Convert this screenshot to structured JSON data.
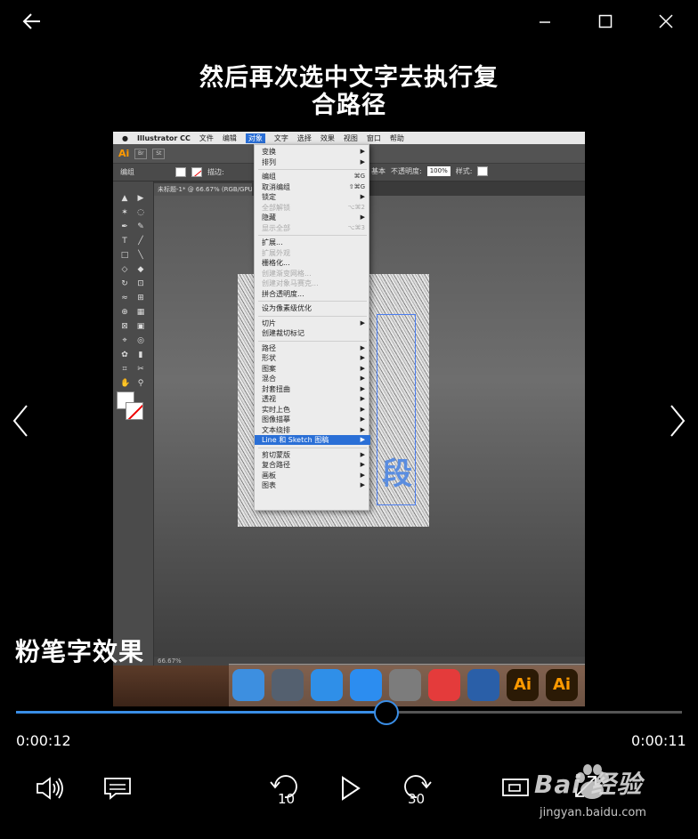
{
  "window": {
    "back_icon": "arrow-left-icon",
    "minimize_icon": "minimize-icon",
    "maximize_icon": "maximize-icon",
    "close_icon": "close-icon"
  },
  "caption": {
    "line1": "然后再次选中文字去执行复",
    "line2": "合路径"
  },
  "video": {
    "menubar": [
      "Illustrator CC",
      "文件",
      "编辑",
      "对象",
      "文字",
      "选择",
      "效果",
      "视图",
      "窗口",
      "帮助"
    ],
    "active_menu": "对象",
    "ai_logo": "Ai",
    "appbar_icons": [
      "Br",
      "St"
    ],
    "control_bar": {
      "left_label": "编组",
      "stroke_label": "描边:",
      "basic_label": "基本",
      "opacity_label": "不透明度:",
      "opacity_value": "100%",
      "style_label": "样式:"
    },
    "doc_tab": "未标题-1* @ 66.67% (RGB/GPU",
    "status_zoom": "66.67%",
    "menu_items": [
      {
        "label": "变换",
        "sub": true
      },
      {
        "label": "排列",
        "sub": true
      },
      {
        "sep": true
      },
      {
        "label": "编组",
        "shortcut": "⌘G"
      },
      {
        "label": "取消编组",
        "shortcut": "⇧⌘G"
      },
      {
        "label": "锁定",
        "sub": true
      },
      {
        "label": "全部解锁",
        "shortcut": "⌥⌘2",
        "dim": true
      },
      {
        "label": "隐藏",
        "sub": true
      },
      {
        "label": "显示全部",
        "shortcut": "⌥⌘3",
        "dim": true
      },
      {
        "sep": true
      },
      {
        "label": "扩展..."
      },
      {
        "label": "扩展外观",
        "dim": true
      },
      {
        "label": "栅格化..."
      },
      {
        "label": "创建渐变网格...",
        "dim": true
      },
      {
        "label": "创建对象马赛克...",
        "dim": true
      },
      {
        "label": "拼合透明度..."
      },
      {
        "sep": true
      },
      {
        "label": "设为像素级优化"
      },
      {
        "sep": true
      },
      {
        "label": "切片",
        "sub": true
      },
      {
        "label": "创建裁切标记"
      },
      {
        "sep": true
      },
      {
        "label": "路径",
        "sub": true
      },
      {
        "label": "形状",
        "sub": true
      },
      {
        "label": "图案",
        "sub": true
      },
      {
        "label": "混合",
        "sub": true
      },
      {
        "label": "封套扭曲",
        "sub": true
      },
      {
        "label": "透视",
        "sub": true
      },
      {
        "label": "实时上色",
        "sub": true
      },
      {
        "label": "图像描摹",
        "sub": true
      },
      {
        "label": "文本绕排",
        "sub": true
      },
      {
        "label": "Line 和 Sketch 图稿",
        "sub": true,
        "highlight": true
      },
      {
        "sep": true
      },
      {
        "label": "剪切蒙版",
        "sub": true
      },
      {
        "label": "复合路径",
        "sub": true
      },
      {
        "label": "画板",
        "sub": true
      },
      {
        "label": "图表",
        "sub": true
      }
    ],
    "glyph": "段",
    "dock_icons": [
      "finder-icon",
      "launchpad-icon",
      "safari-icon",
      "app-store-icon",
      "system-preferences-icon",
      "xmind-icon",
      "cinema4d-icon",
      "illustrator-icon",
      "illustrator-icon",
      "premiere-icon"
    ],
    "dock_ai_label": "Ai"
  },
  "subtitle": "粉笔字效果",
  "player": {
    "progress": 0.556,
    "time_elapsed": "0:00:12",
    "time_remaining": "0:00:11",
    "skip_back_label": "10",
    "skip_forward_label": "30"
  },
  "watermark": {
    "text": "Bai 经验",
    "url": "jingyan.baidu.com"
  },
  "colors": {
    "accent": "#3a8ee6",
    "background": "#000000"
  }
}
